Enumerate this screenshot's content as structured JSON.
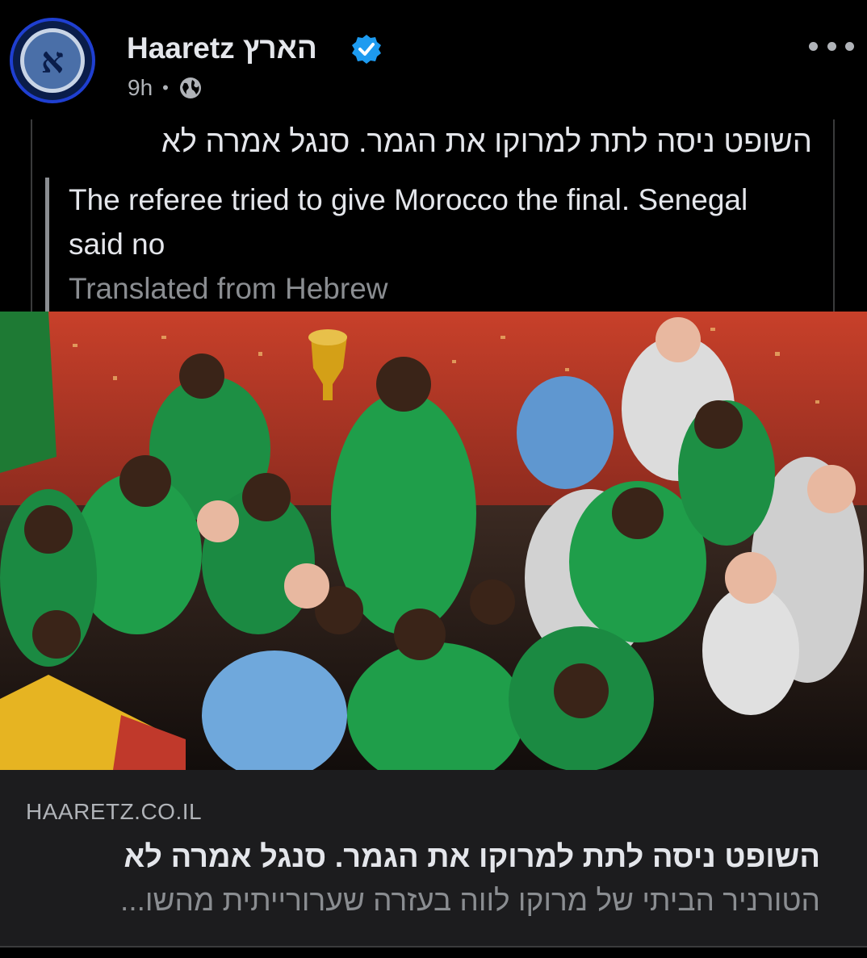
{
  "post": {
    "page_name": "Haaretz הארץ",
    "avatar_letter": "א",
    "time": "9h",
    "separator": "•",
    "caption_hebrew": "השופט ניסה לתת למרוקו את הגמר. סנגל אמרה לא",
    "translation": "The referee tried to give Morocco the final. Senegal said no",
    "translated_from": "Translated from Hebrew"
  },
  "link_preview": {
    "domain": "HAARETZ.CO.IL",
    "title": "השופט ניסה לתת למרוקו את הגמר. סנגל אמרה לא",
    "description": "הטורניר הביתי של מרוקו לווה בעזרה שערורייתית מהשו..."
  },
  "icons": {
    "verified": "verified-badge-icon",
    "audience": "globe-icon",
    "menu": "more-options-icon"
  },
  "colors": {
    "background": "#000000",
    "card": "#1c1c1e",
    "verified": "#1d9bf0",
    "text_primary": "#e4e6eb",
    "text_secondary": "#b0b3b8",
    "jersey_green": "#1f9e4a"
  }
}
